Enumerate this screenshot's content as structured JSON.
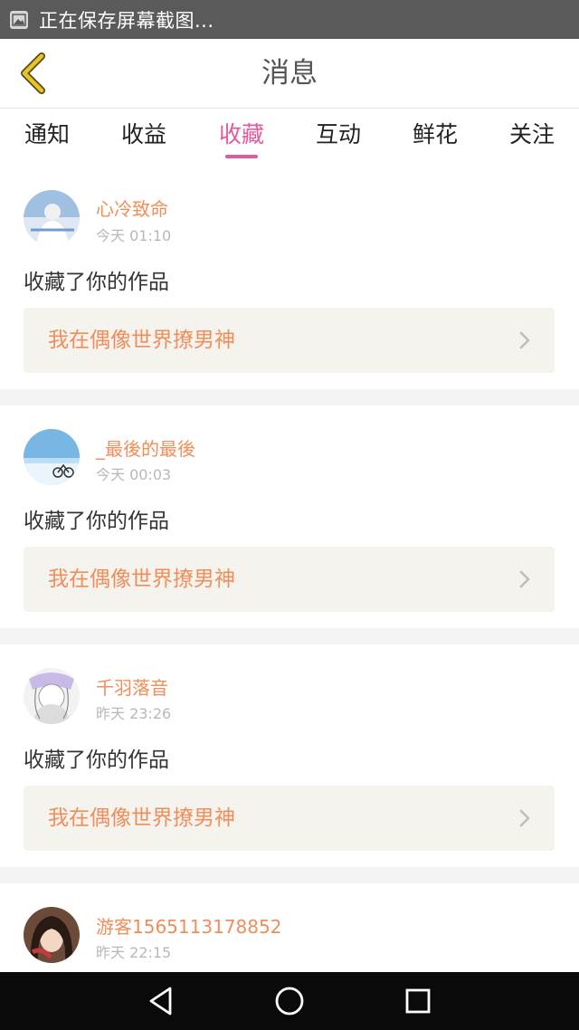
{
  "status_bar": {
    "text": "正在保存屏幕截图...",
    "icon": "image-icon"
  },
  "header": {
    "title": "消息",
    "back_icon": "chevron-left-icon",
    "accent": "#e8c229"
  },
  "tabs": [
    {
      "label": "通知",
      "active": false
    },
    {
      "label": "收益",
      "active": false
    },
    {
      "label": "收藏",
      "active": true
    },
    {
      "label": "互动",
      "active": false
    },
    {
      "label": "鲜花",
      "active": false
    },
    {
      "label": "关注",
      "active": false
    }
  ],
  "colors": {
    "active_tab": "#e15a9b",
    "username": "#ef8e5a",
    "work_title": "#ef8e5a",
    "box_bg": "#f4f3ee"
  },
  "feed": [
    {
      "username": "心冷致命",
      "time": "今天 01:10",
      "action": "收藏了你的作品",
      "work": "我在偶像世界撩男神"
    },
    {
      "username": "_最後的最後",
      "time": "今天 00:03",
      "action": "收藏了你的作品",
      "work": "我在偶像世界撩男神"
    },
    {
      "username": "千羽落音",
      "time": "昨天 23:26",
      "action": "收藏了你的作品",
      "work": "我在偶像世界撩男神"
    },
    {
      "username": "游客1565113178852",
      "time": "昨天 22:15"
    }
  ],
  "nav_bar": {
    "back": "back-triangle-icon",
    "home": "home-circle-icon",
    "recents": "recents-square-icon"
  }
}
